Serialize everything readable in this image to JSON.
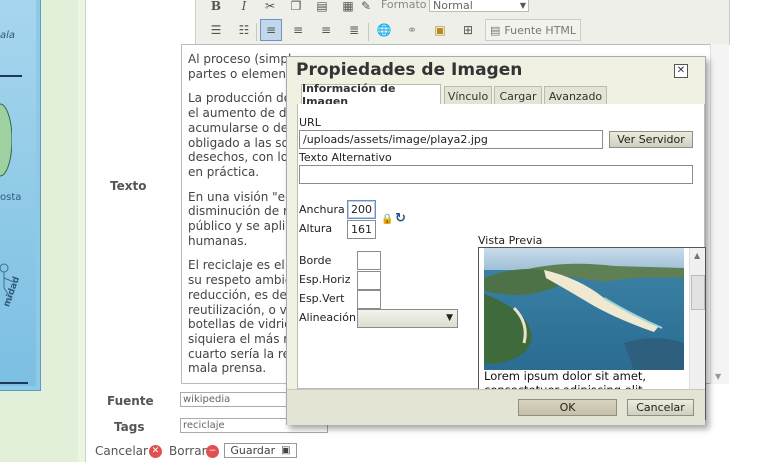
{
  "left": {
    "top_fragment": "ala",
    "mid_word": "osta",
    "bottom_word": "midad"
  },
  "form": {
    "texto_label": "Texto",
    "fuente_label": "Fuente",
    "tags_label": "Tags",
    "fuente_value": "wikipedia",
    "tags_value": "reciclaje"
  },
  "toolbar": {
    "bold": "B",
    "italic": "I",
    "formato_label": "Formato",
    "formato_value": "Normal",
    "fuente_html": "Fuente HTML"
  },
  "editor": {
    "paragraphs": [
      "Al proceso (simple\npartes o elemento",
      "La producción de\nel aumento de de\nacumularse o des\nobligado a las soc\ndesechos, con lo c\nen práctica.",
      "En una visión \"eco\ndisminución de re\npúblico y se aplica\nhumanas.",
      "El reciclaje es el te\nsu respeto ambien\nreducción, es dec\nreutilización, o vo\nbotellas de vidrio r\nsiquiera el más re\ncuarto sería la rec\nmala prensa."
    ]
  },
  "actions": {
    "cancelar": "Cancelar",
    "borrar": "Borrar",
    "guardar": "Guardar"
  },
  "dialog": {
    "title": "Propiedades de Imagen",
    "tabs": [
      "Información de Imagen",
      "Vínculo",
      "Cargar",
      "Avanzado"
    ],
    "url_label": "URL",
    "url_value": "/uploads/assets/image/playa2.jpg",
    "browse_button": "Ver Servidor",
    "alt_label": "Texto Alternativo",
    "alt_value": "",
    "width_label": "Anchura",
    "width_value": "200",
    "height_label": "Altura",
    "height_value": "161",
    "border_label": "Borde",
    "hspace_label": "Esp.Horiz",
    "vspace_label": "Esp.Vert",
    "align_label": "Alineación",
    "align_value": "",
    "preview_label": "Vista Previa",
    "preview_text": "Lorem ipsum dolor sit amet, consectetuer adipiscing elit. Maecenas feugiat consequat diam. Maecenas metus. Vivamus diam",
    "ok_button": "OK",
    "cancel_button": "Cancelar"
  }
}
